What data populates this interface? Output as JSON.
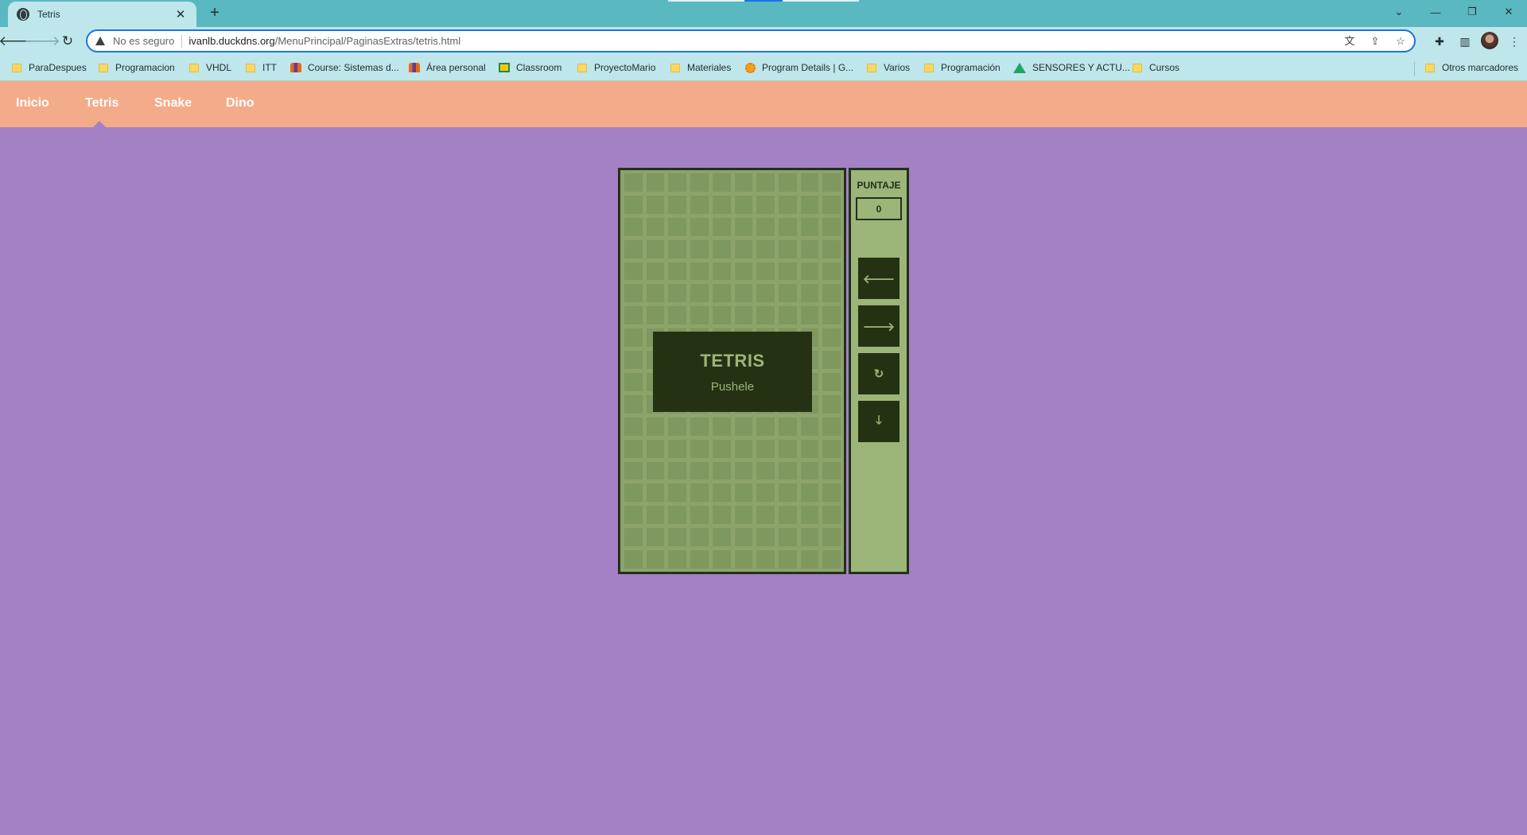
{
  "browser": {
    "tab_title": "Tetris",
    "close_symbol": "✕",
    "newtab_symbol": "+",
    "security_label": "No es seguro",
    "url_host": "ivanlb.duckdns.org",
    "url_path": "/MenuPrincipal/PaginasExtras/tetris.html",
    "bookmarks": [
      {
        "label": "ParaDespues",
        "icon": "folder-icon"
      },
      {
        "label": "Programacion",
        "icon": "folder-icon"
      },
      {
        "label": "VHDL",
        "icon": "folder-icon"
      },
      {
        "label": "ITT",
        "icon": "folder-icon"
      },
      {
        "label": "Course: Sistemas d...",
        "icon": "moodle-icon"
      },
      {
        "label": "Área personal",
        "icon": "moodle-icon"
      },
      {
        "label": "Classroom",
        "icon": "classroom-icon"
      },
      {
        "label": "ProyectoMario",
        "icon": "folder-icon"
      },
      {
        "label": "Materiales",
        "icon": "folder-icon"
      },
      {
        "label": "Program Details | G...",
        "icon": "program-icon"
      },
      {
        "label": "Varios",
        "icon": "folder-icon"
      },
      {
        "label": "Programación",
        "icon": "folder-icon"
      },
      {
        "label": "SENSORES Y ACTU...",
        "icon": "drive-icon"
      },
      {
        "label": "Cursos",
        "icon": "folder-icon"
      }
    ],
    "other_bookmarks": "Otros marcadores"
  },
  "site_nav": {
    "items": [
      "Inicio",
      "Tetris",
      "Snake",
      "Dino"
    ],
    "active": "Tetris"
  },
  "game": {
    "title": "TETRIS",
    "subtitle": "Pushele",
    "score_label": "PUNTAJE",
    "score_value": "0",
    "controls": [
      {
        "name": "left",
        "glyph": "🡐"
      },
      {
        "name": "right",
        "glyph": "🡒"
      },
      {
        "name": "rotate",
        "glyph": "↻"
      },
      {
        "name": "down",
        "glyph": "🡓"
      }
    ]
  },
  "colors": {
    "page_bg": "#a381c4",
    "nav_bg": "#f4ab8a",
    "board_bg": "#8da36a",
    "panel_bg": "#9cb578",
    "dark": "#243213"
  }
}
